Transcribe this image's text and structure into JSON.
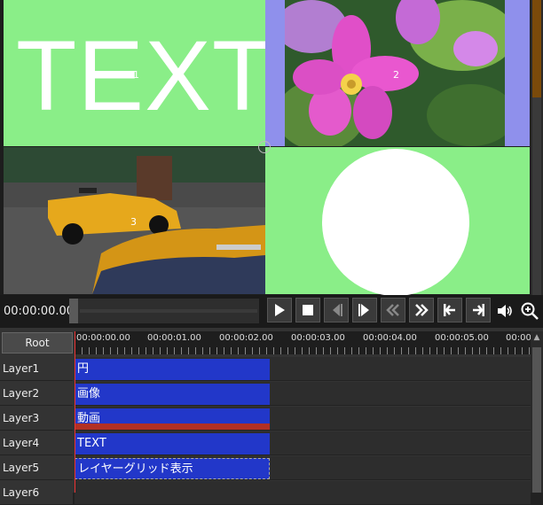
{
  "preview": {
    "text_object": "TEXT",
    "panel_numbers": [
      "1",
      "2",
      "3"
    ]
  },
  "transport": {
    "time": "00:00:00.00",
    "buttons": [
      "play",
      "stop",
      "prev-frame",
      "next-frame",
      "rewind",
      "fast-forward",
      "go-to-start",
      "go-to-end"
    ],
    "icons": [
      "volume-icon",
      "zoom-in-icon"
    ]
  },
  "timeline": {
    "root_label": "Root",
    "ruler": [
      "00:00:00.00",
      "00:00:01.00",
      "00:00:02.00",
      "00:00:03.00",
      "00:00:04.00",
      "00:00:05.00",
      "00:00"
    ],
    "layers": [
      {
        "name": "Layer1",
        "clip": "円"
      },
      {
        "name": "Layer2",
        "clip": "画像"
      },
      {
        "name": "Layer3",
        "clip": "動画"
      },
      {
        "name": "Layer4",
        "clip": "TEXT"
      },
      {
        "name": "Layer5",
        "clip": "レイヤーグリッド表示"
      },
      {
        "name": "Layer6",
        "clip": ""
      }
    ]
  },
  "colors": {
    "green_bg": "#8aee88",
    "purple_bg": "#8f90ec",
    "clip_blue": "#2237c9",
    "video_red": "#b23024",
    "playhead": "#ee3333"
  }
}
